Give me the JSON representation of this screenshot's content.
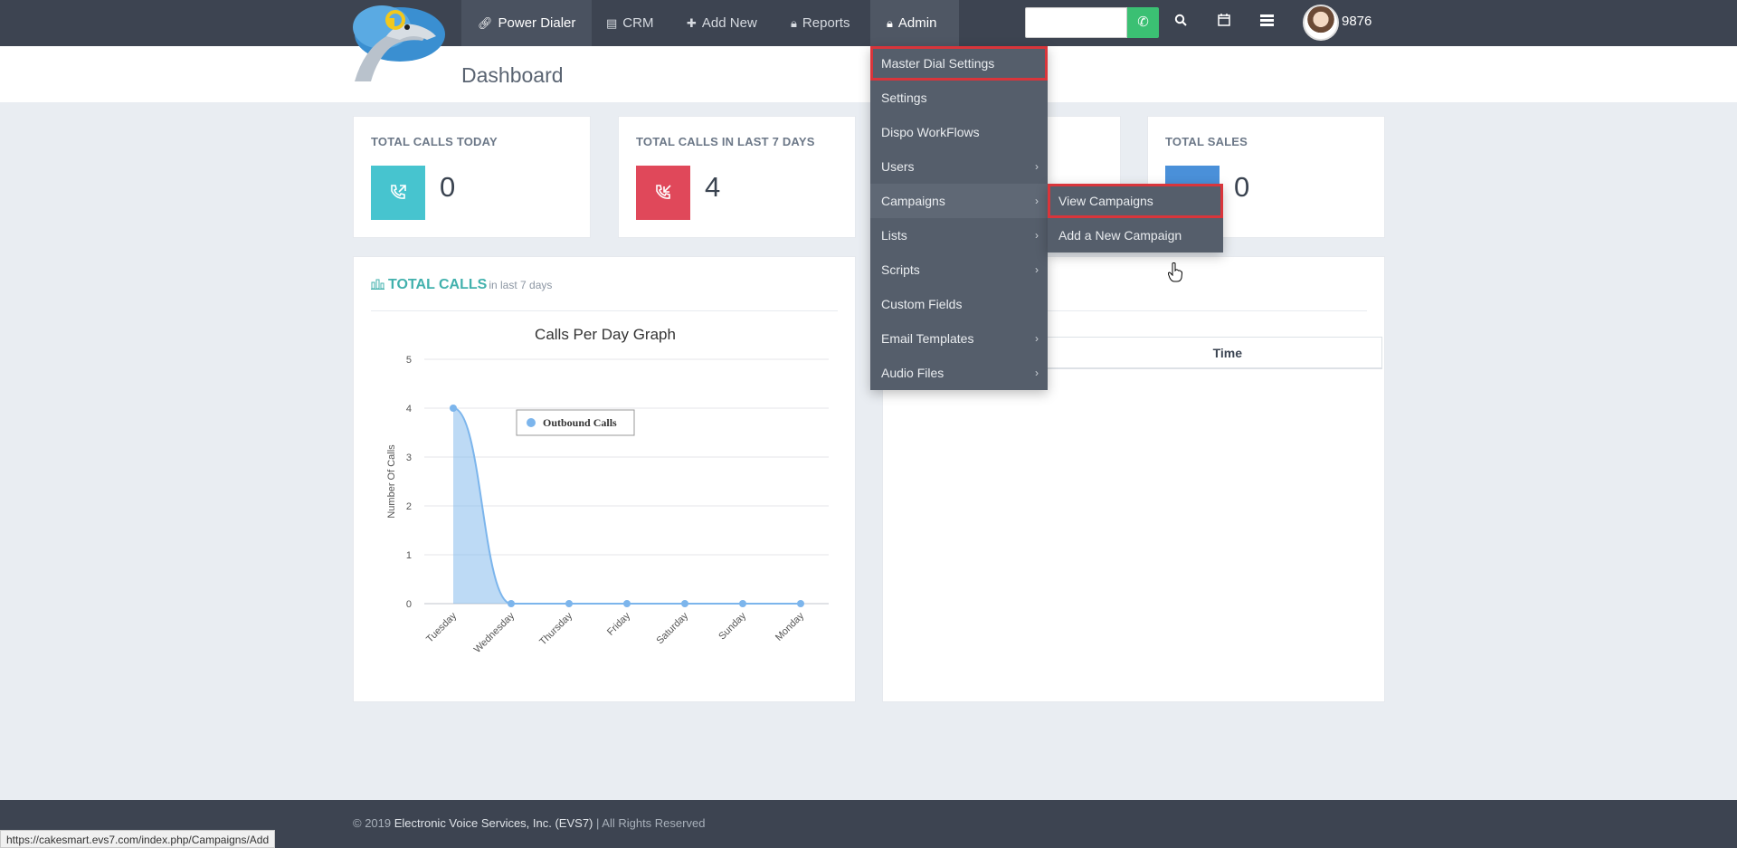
{
  "nav": {
    "items": [
      {
        "label": "Power Dialer",
        "icon": "link-icon"
      },
      {
        "label": "CRM",
        "icon": "book-icon"
      },
      {
        "label": "Add New",
        "icon": "plus-icon"
      },
      {
        "label": "Reports",
        "icon": "lock-icon"
      },
      {
        "label": "Admin",
        "icon": "lock-icon"
      }
    ],
    "user_id": "9876"
  },
  "page": {
    "title": "Dashboard"
  },
  "stats": [
    {
      "title": "TOTAL CALLS TODAY",
      "value": "0",
      "color": "#47c4cf"
    },
    {
      "title": "TOTAL CALLS IN LAST 7 DAYS",
      "value": "4",
      "color": "#e0485a"
    },
    {
      "title": "TOTAL SALES",
      "value": "0",
      "color": "#4a90d9"
    }
  ],
  "calls_panel": {
    "title": "TOTAL CALLS",
    "subtitle": "in last 7 days"
  },
  "chart_data": {
    "type": "area",
    "title": "Calls Per Day Graph",
    "ylabel": "Number Of Calls",
    "xlabel": "",
    "categories": [
      "Tuesday",
      "Wednesday",
      "Thursday",
      "Friday",
      "Saturday",
      "Sunday",
      "Monday"
    ],
    "series": [
      {
        "name": "Outbound Calls",
        "values": [
          4,
          0,
          0,
          0,
          0,
          0,
          0
        ],
        "color": "#7cb5ec"
      }
    ],
    "ylim": [
      0,
      5
    ],
    "yticks": [
      "0",
      "1",
      "2",
      "3",
      "4",
      "5"
    ],
    "grid": true,
    "legend": "top-left"
  },
  "right_panel": {
    "table_header": "Time"
  },
  "admin_menu": [
    {
      "label": "Master Dial Settings",
      "submenu": false
    },
    {
      "label": "Settings",
      "submenu": false
    },
    {
      "label": "Dispo WorkFlows",
      "submenu": false
    },
    {
      "label": "Users",
      "submenu": true
    },
    {
      "label": "Campaigns",
      "submenu": true
    },
    {
      "label": "Lists",
      "submenu": true
    },
    {
      "label": "Scripts",
      "submenu": true
    },
    {
      "label": "Custom Fields",
      "submenu": false
    },
    {
      "label": "Email Templates",
      "submenu": true
    },
    {
      "label": "Audio Files",
      "submenu": true
    }
  ],
  "campaigns_submenu": [
    {
      "label": "View Campaigns"
    },
    {
      "label": "Add a New Campaign"
    }
  ],
  "footer": {
    "prefix": "© 2019 ",
    "company": "Electronic Voice Services, Inc. (EVS7)",
    "suffix": " | All Rights Reserved"
  },
  "status_url": "https://cakesmart.evs7.com/index.php/Campaigns/Add"
}
